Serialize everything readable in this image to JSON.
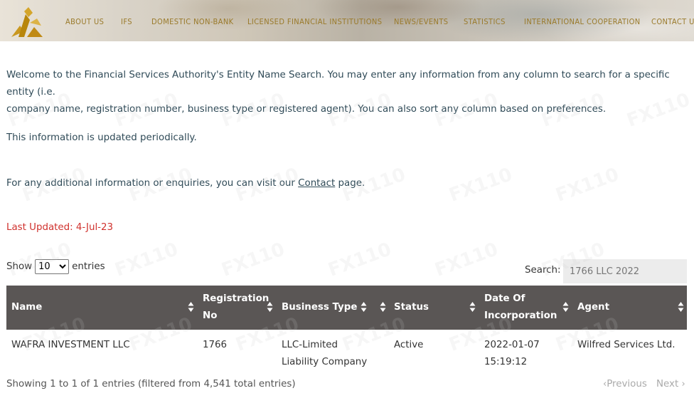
{
  "header": {
    "nav": [
      {
        "label": "ABOUT US",
        "name": "nav-about-us"
      },
      {
        "label": "IFS",
        "name": "nav-ifs"
      },
      {
        "label": "DOMESTIC NON-BANK",
        "name": "nav-domestic-non-bank"
      },
      {
        "label": "LICENSED FINANCIAL INSTITUTIONS",
        "name": "nav-licensed-financial-institutions"
      },
      {
        "label": "NEWS/EVENTS",
        "name": "nav-news-events"
      },
      {
        "label": "STATISTICS",
        "name": "nav-statistics"
      },
      {
        "label": "INTERNATIONAL COOPERATION",
        "name": "nav-international-cooperation"
      },
      {
        "label": "CONTACT US",
        "name": "nav-contact-us"
      }
    ],
    "accent_color": "#9a7a2a"
  },
  "intro": {
    "line1": "Welcome to the Financial Services Authority's Entity Name Search. You may enter any information from any column to search for a specific entity (i.e.",
    "line2": "company name, registration number, business type or registered agent). You can also sort any column based on preferences.",
    "updated_note": "This information is updated periodically.",
    "contact_before": "For any additional information or enquiries, you can visit our ",
    "contact_link": "Contact",
    "contact_after": " page.",
    "last_updated": "Last Updated:  4-Jul-23"
  },
  "controls": {
    "show_label": "Show",
    "entries_label": "entries",
    "page_size": "10",
    "search_label": "Search:",
    "search_value": "1766 LLC 2022"
  },
  "table": {
    "columns": [
      {
        "line1": "Name",
        "line2": ""
      },
      {
        "line1": "Registration",
        "line2": "No"
      },
      {
        "line1": "Business Type",
        "line2": ""
      },
      {
        "line1": "Status",
        "line2": ""
      },
      {
        "line1": "Date Of",
        "line2": "Incorporation"
      },
      {
        "line1": "Agent",
        "line2": ""
      }
    ],
    "rows": [
      {
        "name": "WAFRA INVESTMENT LLC",
        "registration_no": "1766",
        "business_type_1": "LLC-Limited",
        "business_type_2": "Liability Company",
        "status": "Active",
        "date_1": "2022-01-07",
        "date_2": "15:19:12",
        "agent": "Wilfred Services Ltd."
      }
    ],
    "header_bg": "#5a5655"
  },
  "footer": {
    "info": "Showing 1 to 1 of 1 entries (filtered from 4,541 total entries)",
    "previous": "Previous",
    "next": "Next"
  },
  "status_color": "#d0312d"
}
